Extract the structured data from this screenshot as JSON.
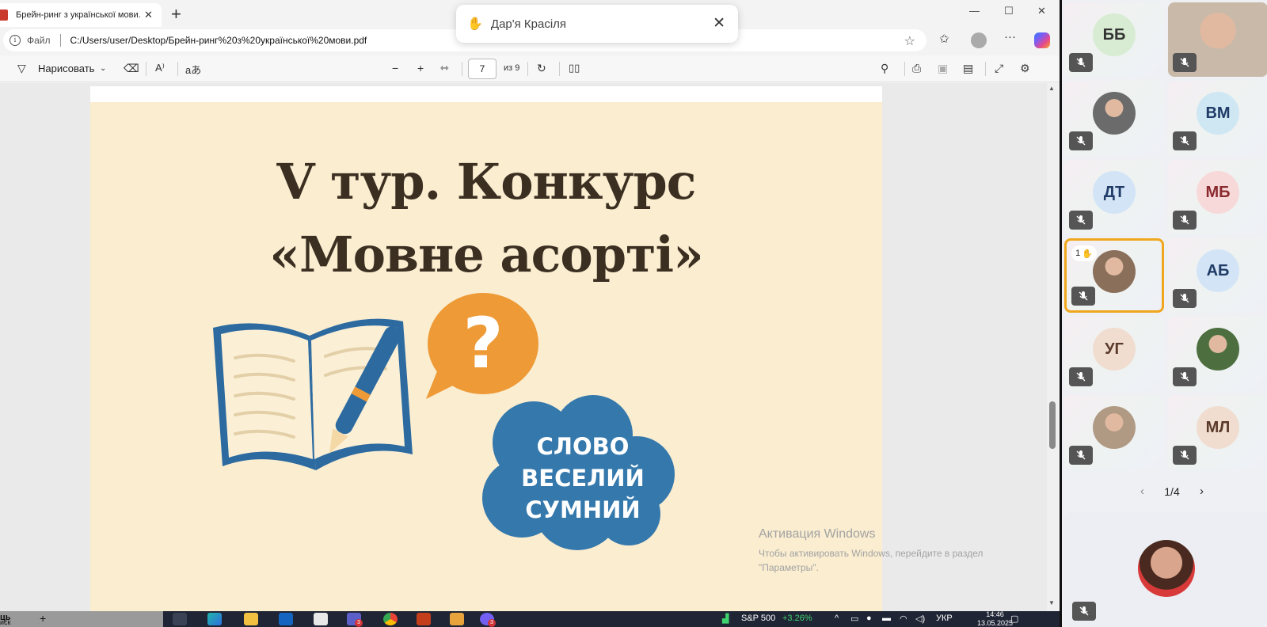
{
  "browser": {
    "tab_title": "Брейн-ринг з української мови.p",
    "address_label": "Файл",
    "url": "C:/Users/user/Desktop/Брейн-ринг%20з%20української%20мови.pdf"
  },
  "pdf_toolbar": {
    "draw_label": "Нарисовать",
    "page_current": "7",
    "page_total": "из 9"
  },
  "toast": {
    "name": "Дар'я Красіля"
  },
  "slide": {
    "title_line1": "V тур. Конкурс",
    "title_line2": "«Мовне асорті»",
    "cloud_line1": "СЛОВО",
    "cloud_line2": "ВЕСЕЛИЙ",
    "cloud_line3": "СУМНИЙ"
  },
  "watermark": {
    "title": "Активация Windows",
    "line1": "Чтобы активировать Windows, перейдите в раздел",
    "line2": "\"Параметры\"."
  },
  "meeting": {
    "participants": [
      {
        "initials": "ББ",
        "bg": "#d8ecd3",
        "color": "#333333"
      },
      {
        "initials": "",
        "photo": "#c9b9a8"
      },
      {
        "initials": "",
        "photo": "#6b6b6b"
      },
      {
        "initials": "ВМ",
        "bg": "#cfe6f3",
        "color": "#1f3b66"
      },
      {
        "initials": "ДТ",
        "bg": "#d2e4f6",
        "color": "#1f3b66"
      },
      {
        "initials": "МБ",
        "bg": "#f8d9da",
        "color": "#8a2a2f"
      },
      {
        "initials": "",
        "photo": "#8a6f5a",
        "raised_hand": "1"
      },
      {
        "initials": "АБ",
        "bg": "#d2e4f6",
        "color": "#1f3b66"
      },
      {
        "initials": "УГ",
        "bg": "#f0ddd0",
        "color": "#5a3a2a"
      },
      {
        "initials": "",
        "photo": "#4d6f3f"
      },
      {
        "initials": "",
        "photo": "#b09a84"
      },
      {
        "initials": "МЛ",
        "bg": "#f0ddd0",
        "color": "#5a3a2a"
      }
    ],
    "pager": "1/4"
  },
  "taskbar": {
    "left_text": "ць",
    "left_sub": "иск",
    "stock_label": "S&P 500",
    "stock_change": "+3.26%",
    "language": "УКР",
    "time": "14:46",
    "date": "13.05.2025",
    "teams_badge": "3",
    "viber_badge": "3"
  },
  "colors": {
    "slide_bg": "#faedd0",
    "title_color": "#3b2f22",
    "book_blue": "#2c6aa0",
    "bubble_orange": "#ee9a36",
    "cloud_blue": "#3478ac",
    "active_speaker": "#f0a71d"
  }
}
